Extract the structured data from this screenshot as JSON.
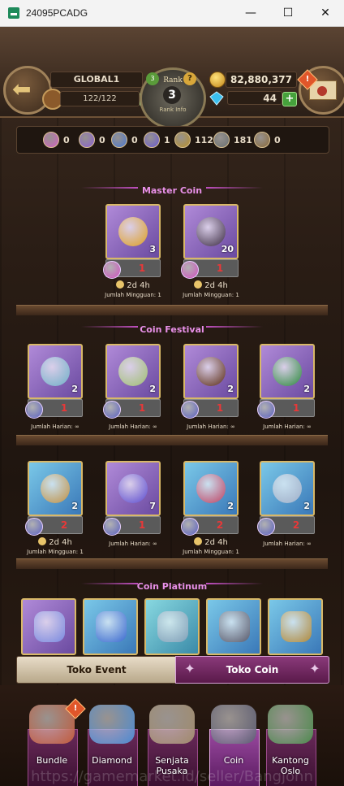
{
  "window": {
    "title": "24095PCADG",
    "minimize": "—",
    "maximize": "☐",
    "close": "✕"
  },
  "header": {
    "global_label": "GLOBAL1",
    "stamina": "122/122",
    "rank_label": "Rank",
    "rank_value": "3",
    "rank_sub": "Rank Info",
    "rank_left_badge": "3",
    "rank_right_badge": "?",
    "gold": "82,880,377",
    "diamonds": "44",
    "mail_alert": "!"
  },
  "currencies": [
    {
      "icon": "pink-coin-icon",
      "color": "#d060c0",
      "count": "0"
    },
    {
      "icon": "violet-coin-icon",
      "color": "#8a60d0",
      "count": "0"
    },
    {
      "icon": "blue-coin-icon",
      "color": "#4a78d0",
      "count": "0"
    },
    {
      "icon": "indigo-coin-icon",
      "color": "#6a5ad0",
      "count": "1"
    },
    {
      "icon": "gold-coin-icon",
      "color": "#b8902a",
      "count": "112"
    },
    {
      "icon": "gray-coin-icon",
      "color": "#6a7070",
      "count": "181"
    },
    {
      "icon": "bronze-coin-icon",
      "color": "#8a6a3a",
      "count": "0"
    }
  ],
  "sections": {
    "master": "Master Coin",
    "festival": "Coin Festival",
    "platinum": "Coin Platinum"
  },
  "master_items": [
    {
      "name": "golden-amulet",
      "stock": "3",
      "price": "1",
      "timer": "2d 4h",
      "quota": "Jumlah Mingguan: 1",
      "frame": "purple",
      "art": "#e0a020",
      "coin": "#d050c0"
    },
    {
      "name": "dark-beast",
      "stock": "20",
      "price": "1",
      "timer": "2d 4h",
      "quota": "Jumlah Mingguan: 1",
      "frame": "purple",
      "art": "#3a2a40",
      "coin": "#d050c0"
    }
  ],
  "festival_row1": [
    {
      "name": "compass-gem",
      "stock": "2",
      "price": "1",
      "quota": "Jumlah Harian: ∞",
      "frame": "purple",
      "art": "#70b0c8",
      "coin": "#5a60c0"
    },
    {
      "name": "herb-bowl",
      "stock": "2",
      "price": "1",
      "quota": "Jumlah Harian: ∞",
      "frame": "purple",
      "art": "#a0c070",
      "coin": "#5a60c0"
    },
    {
      "name": "dark-orb",
      "stock": "2",
      "price": "1",
      "quota": "Jumlah Harian: ∞",
      "frame": "purple",
      "art": "#5a2a10",
      "coin": "#5a60c0"
    },
    {
      "name": "green-sphere",
      "stock": "2",
      "price": "1",
      "quota": "Jumlah Harian: ∞",
      "frame": "purple",
      "art": "#2a8a3a",
      "coin": "#5a60c0"
    }
  ],
  "festival_row2": [
    {
      "name": "hourglass",
      "stock": "2",
      "price": "2",
      "timer": "2d 4h",
      "quota": "Jumlah Mingguan: 1",
      "frame": "blue",
      "art": "#c09040",
      "coin": "#5a60c0"
    },
    {
      "name": "crystal-orb",
      "stock": "7",
      "price": "1",
      "quota": "Jumlah Harian: ∞",
      "frame": "purple",
      "art": "#5a4ad0",
      "coin": "#5a60c0"
    },
    {
      "name": "ruby-gem",
      "stock": "2",
      "price": "2",
      "timer": "2d 4h",
      "quota": "Jumlah Mingguan: 1",
      "frame": "blue",
      "art": "#c04060",
      "coin": "#5a60c0"
    },
    {
      "name": "silver-weapons",
      "stock": "2",
      "price": "2",
      "quota": "Jumlah Harian: ∞",
      "frame": "blue",
      "art": "#a0b0c8",
      "coin": "#5a60c0"
    }
  ],
  "platinum_items": [
    {
      "name": "blue-crystal",
      "frame": "purple",
      "art": "#7a8ae0"
    },
    {
      "name": "sapphire-necklace",
      "frame": "blue",
      "art": "#3a6ad0"
    },
    {
      "name": "silver-bracelet",
      "frame": "cyan",
      "art": "#80a0b8"
    },
    {
      "name": "iron-chest",
      "frame": "blue",
      "art": "#5a5a6a"
    },
    {
      "name": "golden-chest",
      "frame": "blue",
      "art": "#b08a3a"
    }
  ],
  "tabs": {
    "event": "Toko Event",
    "coin": "Toko Coin"
  },
  "nav": [
    {
      "label": "Bundle",
      "color": "#c05a3a"
    },
    {
      "label": "Diamond",
      "color": "#4a8ad0"
    },
    {
      "label": "Senjata Pusaka",
      "color": "#a08a6a"
    },
    {
      "label": "Coin",
      "color": "#5a5a70"
    },
    {
      "label": "Kantong Oslo",
      "color": "#4a8a4a"
    }
  ],
  "nav_alert": "!",
  "watermark": "https://gamemarket.id/seller/Bangjohn"
}
